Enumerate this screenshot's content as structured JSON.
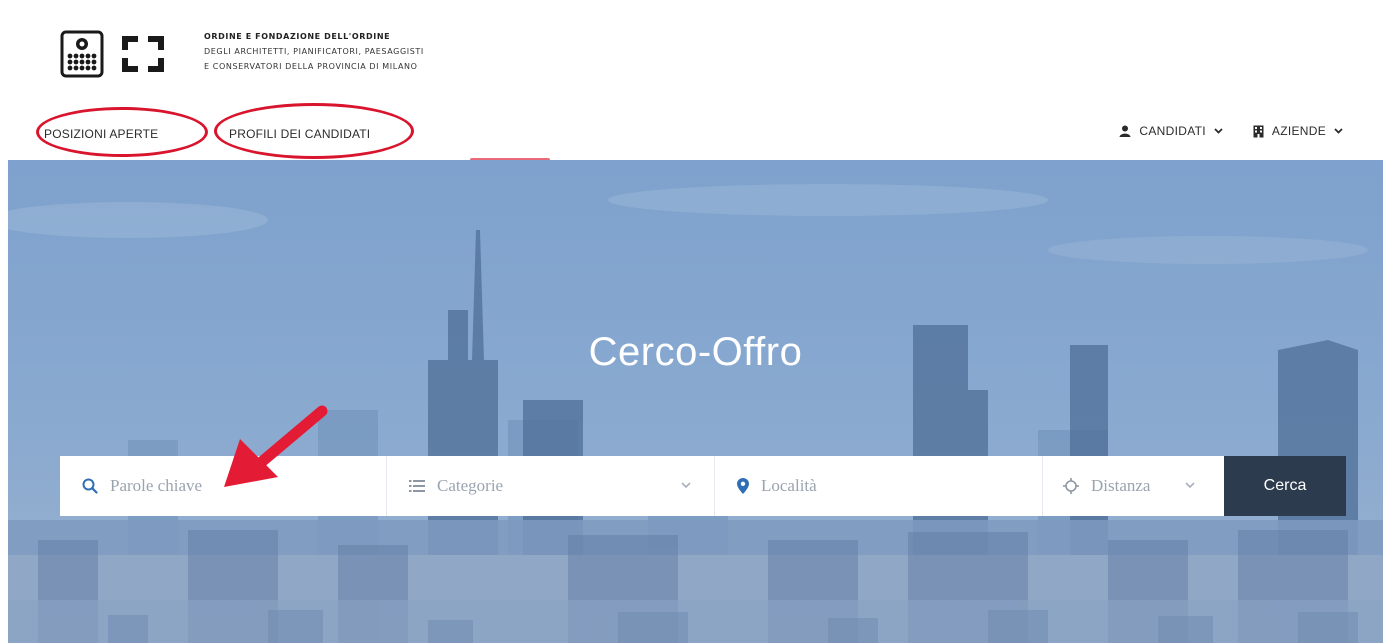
{
  "header": {
    "logo_lines": [
      "ORDINE E FONDAZIONE DELL'ORDINE",
      "DEGLI ARCHITETTI, PIANIFICATORI, PAESAGGISTI",
      "E CONSERVATORI DELLA PROVINCIA DI MILANO"
    ],
    "nav_left": [
      "POSIZIONI APERTE",
      "PROFILI DEI CANDIDATI"
    ],
    "nav_right": [
      {
        "label": "CANDIDATI",
        "icon": "user-icon"
      },
      {
        "label": "AZIENDE",
        "icon": "building-icon"
      }
    ]
  },
  "hero": {
    "title": "Cerco-Offro"
  },
  "search": {
    "keywords_placeholder": "Parole chiave",
    "categories_placeholder": "Categorie",
    "location_placeholder": "Località",
    "distance_placeholder": "Distanza",
    "button_label": "Cerca"
  },
  "annotations": {
    "color": "#d9152e"
  }
}
